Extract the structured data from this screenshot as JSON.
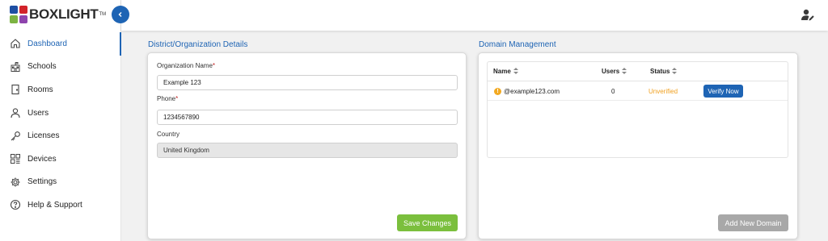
{
  "brand": {
    "name": "BOXLIGHT",
    "tm": "TM",
    "colors": [
      "#1e4fa3",
      "#d2232a",
      "#7cb342",
      "#8e44ad"
    ]
  },
  "sidebar": {
    "items": [
      {
        "label": "Dashboard",
        "icon": "home-icon",
        "active": true
      },
      {
        "label": "Schools",
        "icon": "school-icon",
        "active": false
      },
      {
        "label": "Rooms",
        "icon": "door-icon",
        "active": false
      },
      {
        "label": "Users",
        "icon": "user-icon",
        "active": false
      },
      {
        "label": "Licenses",
        "icon": "key-icon",
        "active": false
      },
      {
        "label": "Devices",
        "icon": "devices-icon",
        "active": false
      },
      {
        "label": "Settings",
        "icon": "gear-icon",
        "active": false
      },
      {
        "label": "Help & Support",
        "icon": "help-icon",
        "active": false
      }
    ]
  },
  "topbar": {
    "collapse_icon": "chevron-left-icon",
    "user_icon": "user-edit-icon"
  },
  "org": {
    "title": "District/Organization Details",
    "name_label": "Organization Name",
    "name_value": "Example 123",
    "phone_label": "Phone",
    "phone_value": "1234567890",
    "country_label": "Country",
    "country_value": "United Kingdom",
    "required_mark": "*",
    "save_label": "Save Changes"
  },
  "domains": {
    "title": "Domain Management",
    "columns": [
      "Name",
      "Users",
      "Status"
    ],
    "rows": [
      {
        "name": "@example123.com",
        "users": "0",
        "status": "Unverified",
        "action": "Verify Now",
        "warning_icon": "!"
      }
    ],
    "add_label": "Add New Domain"
  },
  "colors": {
    "primary": "#1e64b4",
    "save": "#7bbf3d",
    "disabled_button": "#a8a8a8",
    "unverified": "#f0a020"
  }
}
